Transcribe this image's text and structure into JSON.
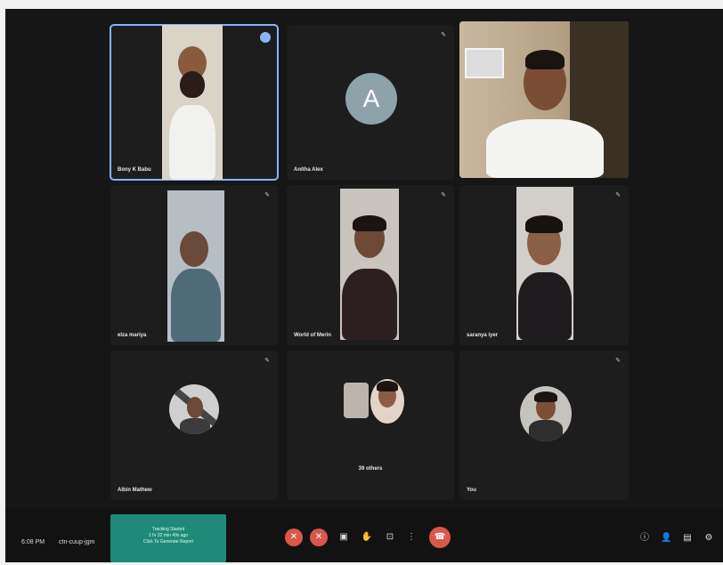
{
  "participants": {
    "bony": {
      "name": "Bony K Babu"
    },
    "anitha": {
      "name": "Anitha Alex",
      "initial": "A"
    },
    "elza": {
      "name": "elza mariya"
    },
    "world": {
      "name": "World of Merin"
    },
    "saranya": {
      "name": "saranya iyer"
    },
    "albin": {
      "name": "Albin Mathew"
    },
    "others": {
      "label": "39 others"
    },
    "you": {
      "name": "You"
    }
  },
  "bottom_bar": {
    "time": "6:08 PM",
    "meeting_code": "ctn-cuup-jgm",
    "notice": {
      "line1": "Tracking Started",
      "line2": "1 hr 22 min 49s ago",
      "line3": "Click To Generate Report"
    }
  },
  "colors": {
    "background": "#161616",
    "tile": "#1d1d1e",
    "active_border": "#8ab4f8",
    "hangup": "#d9584b",
    "notice": "#1f8a77"
  }
}
